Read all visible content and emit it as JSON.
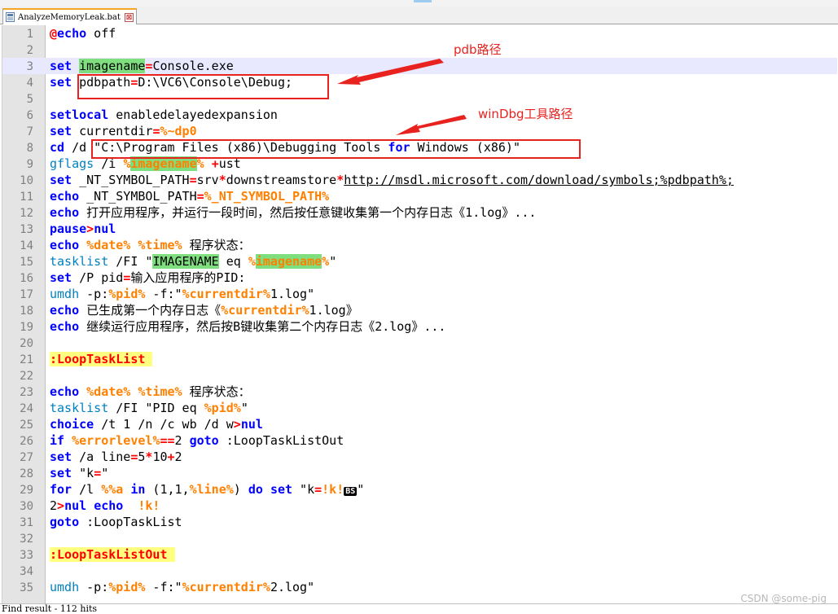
{
  "tab": {
    "label": "AnalyzeMemoryLeak.bat",
    "close_glyph": "⊠",
    "icon": "file-icon"
  },
  "annotations": [
    {
      "text": "pdb路径",
      "color": "#e8231f"
    },
    {
      "text": "winDbg工具路径",
      "color": "#e8231f"
    }
  ],
  "lines": [
    {
      "n": "1",
      "tokens": [
        [
          "o",
          "@"
        ],
        [
          "k",
          "echo"
        ],
        [
          "t",
          " off"
        ]
      ]
    },
    {
      "n": "2",
      "tokens": []
    },
    {
      "n": "3",
      "current": true,
      "tokens": [
        [
          "k",
          "set"
        ],
        [
          "t",
          " "
        ],
        [
          "hl",
          "imagename"
        ],
        [
          "o",
          "="
        ],
        [
          "t",
          "Console.exe"
        ]
      ]
    },
    {
      "n": "4",
      "tokens": [
        [
          "k",
          "set"
        ],
        [
          "t",
          " pdbpath"
        ],
        [
          "o",
          "="
        ],
        [
          "t",
          "D:\\VC6\\Console\\Debug;"
        ]
      ]
    },
    {
      "n": "5",
      "tokens": []
    },
    {
      "n": "6",
      "tokens": [
        [
          "k",
          "setlocal"
        ],
        [
          "t",
          " enabledelayedexpansion"
        ]
      ]
    },
    {
      "n": "7",
      "tokens": [
        [
          "k",
          "set"
        ],
        [
          "t",
          " currentdir"
        ],
        [
          "o",
          "="
        ],
        [
          "v",
          "%~dp0"
        ]
      ]
    },
    {
      "n": "8",
      "tokens": [
        [
          "k",
          "cd"
        ],
        [
          "t",
          " /d \"C:\\Program Files (x86)\\Debugging Tools "
        ],
        [
          "k",
          "for"
        ],
        [
          "t",
          " Windows (x86)\""
        ]
      ]
    },
    {
      "n": "9",
      "tokens": [
        [
          "c",
          "gflags"
        ],
        [
          "t",
          " /i "
        ],
        [
          "v",
          "%"
        ],
        [
          "vh",
          "imagename"
        ],
        [
          "v",
          "%"
        ],
        [
          "t",
          " "
        ],
        [
          "o",
          "+"
        ],
        [
          "t",
          "ust"
        ]
      ]
    },
    {
      "n": "10",
      "tokens": [
        [
          "k",
          "set"
        ],
        [
          "t",
          " _NT_SYMBOL_PATH"
        ],
        [
          "o",
          "="
        ],
        [
          "t",
          "srv"
        ],
        [
          "o",
          "*"
        ],
        [
          "t",
          "downstreamstore"
        ],
        [
          "o",
          "*"
        ],
        [
          "url",
          "http://msdl.microsoft.com/download/symbols;%pdbpath%;"
        ]
      ]
    },
    {
      "n": "11",
      "tokens": [
        [
          "k",
          "echo"
        ],
        [
          "t",
          " _NT_SYMBOL_PATH"
        ],
        [
          "o",
          "="
        ],
        [
          "v",
          "%_NT_SYMBOL_PATH%"
        ]
      ]
    },
    {
      "n": "12",
      "tokens": [
        [
          "k",
          "echo"
        ],
        [
          "t",
          " 打开应用程序，并运行一段时间，然后按任意键收集第一个内存日志《1.log》..."
        ]
      ]
    },
    {
      "n": "13",
      "tokens": [
        [
          "k",
          "pause"
        ],
        [
          "o",
          ">"
        ],
        [
          "k",
          "nul"
        ]
      ]
    },
    {
      "n": "14",
      "tokens": [
        [
          "k",
          "echo"
        ],
        [
          "t",
          " "
        ],
        [
          "v",
          "%date%"
        ],
        [
          "t",
          " "
        ],
        [
          "v",
          "%time%"
        ],
        [
          "t",
          " 程序状态："
        ]
      ]
    },
    {
      "n": "15",
      "tokens": [
        [
          "c",
          "tasklist"
        ],
        [
          "t",
          " /FI \""
        ],
        [
          "hl",
          "IMAGENAME"
        ],
        [
          "t",
          " eq "
        ],
        [
          "v",
          "%"
        ],
        [
          "vh",
          "imagename"
        ],
        [
          "v",
          "%"
        ],
        [
          "t",
          "\""
        ]
      ]
    },
    {
      "n": "16",
      "tokens": [
        [
          "k",
          "set"
        ],
        [
          "t",
          " /P pid"
        ],
        [
          "o",
          "="
        ],
        [
          "t",
          "输入应用程序的PID:"
        ]
      ]
    },
    {
      "n": "17",
      "tokens": [
        [
          "c",
          "umdh"
        ],
        [
          "t",
          " -p:"
        ],
        [
          "v",
          "%pid%"
        ],
        [
          "t",
          " -f:\""
        ],
        [
          "v",
          "%currentdir%"
        ],
        [
          "t",
          "1.log\""
        ]
      ]
    },
    {
      "n": "18",
      "tokens": [
        [
          "k",
          "echo"
        ],
        [
          "t",
          " 已生成第一个内存日志《"
        ],
        [
          "v",
          "%currentdir%"
        ],
        [
          "t",
          "1.log》"
        ]
      ]
    },
    {
      "n": "19",
      "tokens": [
        [
          "k",
          "echo"
        ],
        [
          "t",
          " 继续运行应用程序，然后按B键收集第二个内存日志《2.log》..."
        ]
      ]
    },
    {
      "n": "20",
      "tokens": []
    },
    {
      "n": "21",
      "tokens": [
        [
          "lab",
          ":LoopTaskList "
        ]
      ]
    },
    {
      "n": "22",
      "tokens": []
    },
    {
      "n": "23",
      "tokens": [
        [
          "k",
          "echo"
        ],
        [
          "t",
          " "
        ],
        [
          "v",
          "%date%"
        ],
        [
          "t",
          " "
        ],
        [
          "v",
          "%time%"
        ],
        [
          "t",
          " 程序状态："
        ]
      ]
    },
    {
      "n": "24",
      "tokens": [
        [
          "c",
          "tasklist"
        ],
        [
          "t",
          " /FI \"PID eq "
        ],
        [
          "v",
          "%pid%"
        ],
        [
          "t",
          "\""
        ]
      ]
    },
    {
      "n": "25",
      "tokens": [
        [
          "k",
          "choice"
        ],
        [
          "t",
          " /t 1 /n /c wb /d w"
        ],
        [
          "o",
          ">"
        ],
        [
          "k",
          "nul"
        ]
      ]
    },
    {
      "n": "26",
      "tokens": [
        [
          "k",
          "if"
        ],
        [
          "t",
          " "
        ],
        [
          "v",
          "%errorlevel%"
        ],
        [
          "o",
          "=="
        ],
        [
          "t",
          "2 "
        ],
        [
          "k",
          "goto"
        ],
        [
          "t",
          " :LoopTaskListOut"
        ]
      ]
    },
    {
      "n": "27",
      "tokens": [
        [
          "k",
          "set"
        ],
        [
          "t",
          " /a line"
        ],
        [
          "o",
          "="
        ],
        [
          "t",
          "5"
        ],
        [
          "o",
          "*"
        ],
        [
          "t",
          "10"
        ],
        [
          "o",
          "+"
        ],
        [
          "t",
          "2"
        ]
      ]
    },
    {
      "n": "28",
      "tokens": [
        [
          "k",
          "set"
        ],
        [
          "t",
          " \"k"
        ],
        [
          "o",
          "="
        ],
        [
          "t",
          "\""
        ]
      ]
    },
    {
      "n": "29",
      "tokens": [
        [
          "k",
          "for"
        ],
        [
          "t",
          " /l "
        ],
        [
          "v",
          "%%a"
        ],
        [
          "t",
          " "
        ],
        [
          "k",
          "in"
        ],
        [
          "t",
          " (1,1,"
        ],
        [
          "v",
          "%line%"
        ],
        [
          "t",
          ") "
        ],
        [
          "k",
          "do"
        ],
        [
          "t",
          " "
        ],
        [
          "k",
          "set"
        ],
        [
          "t",
          " \"k"
        ],
        [
          "o",
          "="
        ],
        [
          "v",
          "!k!"
        ],
        [
          "bs",
          "BS"
        ],
        [
          "t",
          "\""
        ]
      ]
    },
    {
      "n": "30",
      "tokens": [
        [
          "t",
          "2"
        ],
        [
          "o",
          ">"
        ],
        [
          "k",
          "nul"
        ],
        [
          "t",
          " "
        ],
        [
          "k",
          "echo"
        ],
        [
          "t",
          "  "
        ],
        [
          "v",
          "!k!"
        ]
      ]
    },
    {
      "n": "31",
      "tokens": [
        [
          "k",
          "goto"
        ],
        [
          "t",
          " :LoopTaskList"
        ]
      ]
    },
    {
      "n": "32",
      "tokens": []
    },
    {
      "n": "33",
      "tokens": [
        [
          "lab",
          ":LoopTaskListOut "
        ]
      ]
    },
    {
      "n": "34",
      "tokens": []
    },
    {
      "n": "35",
      "tokens": [
        [
          "c",
          "umdh"
        ],
        [
          "t",
          " -p:"
        ],
        [
          "v",
          "%pid%"
        ],
        [
          "t",
          " -f:\""
        ],
        [
          "v",
          "%currentdir%"
        ],
        [
          "t",
          "2.log\""
        ]
      ]
    }
  ],
  "status": {
    "text": "Find result - 112 hits"
  },
  "watermark": "CSDN @some-pig",
  "colors": {
    "keyword": "#0000ff",
    "command": "#0080c0",
    "variable": "#ff8000",
    "operator": "#ff0000",
    "highlight": "#7fdf7f",
    "label_bg": "#ffff80",
    "annotation": "#e8231f"
  }
}
